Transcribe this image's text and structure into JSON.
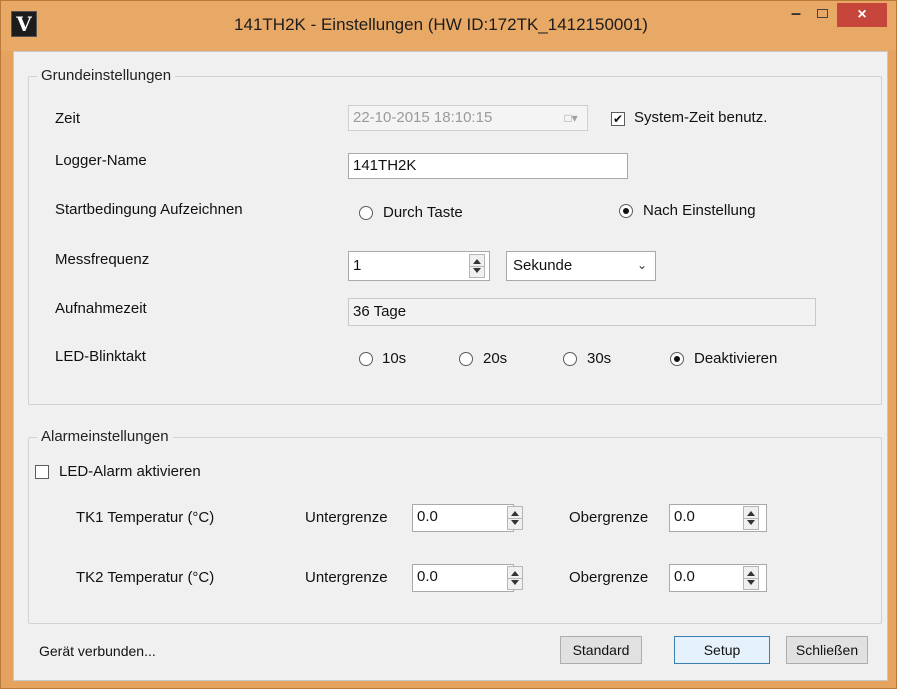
{
  "window": {
    "title": "141TH2K - Einstellungen (HW ID:172TK_1412150001)",
    "icon_letter": "V",
    "minimize_label": "–",
    "close_label": "×"
  },
  "grund": {
    "group_title": "Grundeinstellungen",
    "zeit_label": "Zeit",
    "zeit_value": "22-10-2015 18:10:15",
    "systemzeit_label": "System-Zeit benutz.",
    "systemzeit_checked": true,
    "logger_label": "Logger-Name",
    "logger_value": "141TH2K",
    "start_label": "Startbedingung Aufzeichnen",
    "start_options": [
      "Durch Taste",
      "Nach Einstellung"
    ],
    "start_selected": "Nach Einstellung",
    "mess_label": "Messfrequenz",
    "mess_value": "1",
    "mess_unit": "Sekunde",
    "aufnahme_label": "Aufnahmezeit",
    "aufnahme_value": "36 Tage",
    "led_label": "LED-Blinktakt",
    "led_options": [
      "10s",
      "20s",
      "30s",
      "Deaktivieren"
    ],
    "led_selected": "Deaktivieren"
  },
  "alarm": {
    "group_title": "Alarmeinstellungen",
    "led_alarm_label": "LED-Alarm aktivieren",
    "led_alarm_checked": false,
    "rows": [
      {
        "label": "TK1 Temperatur (°C)",
        "lower_label": "Untergrenze",
        "lower_value": "0.0",
        "upper_label": "Obergrenze",
        "upper_value": "0.0"
      },
      {
        "label": "TK2 Temperatur (°C)",
        "lower_label": "Untergrenze",
        "lower_value": "0.0",
        "upper_label": "Obergrenze",
        "upper_value": "0.0"
      }
    ]
  },
  "footer": {
    "status": "Gerät verbunden...",
    "standard_label": "Standard",
    "setup_label": "Setup",
    "close_label": "Schließen"
  },
  "colors": {
    "title_bar": "#e8a866",
    "close_button": "#c7463b",
    "client_bg": "#f0f0f0"
  }
}
